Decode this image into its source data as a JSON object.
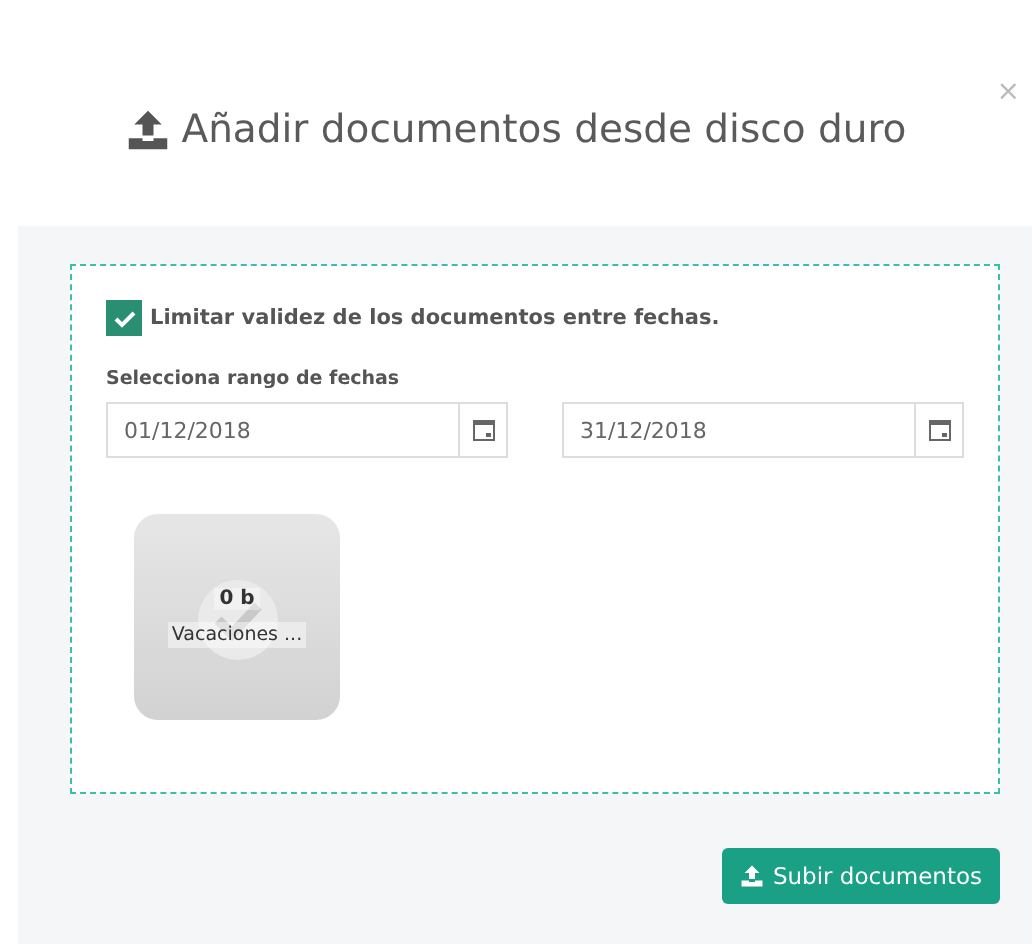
{
  "dialog": {
    "title": "Añadir documentos desde disco duro",
    "close": "×"
  },
  "date_limit": {
    "label": "Limitar validez de los documentos entre fechas.",
    "checked": true
  },
  "date_range": {
    "label": "Selecciona rango de fechas",
    "start": "01/12/2018",
    "end": "31/12/2018"
  },
  "files": [
    {
      "size": "0 b",
      "name": "Vacaciones ...",
      "uploaded": true
    }
  ],
  "buttons": [
    {
      "label": "Subir documentos"
    }
  ]
}
